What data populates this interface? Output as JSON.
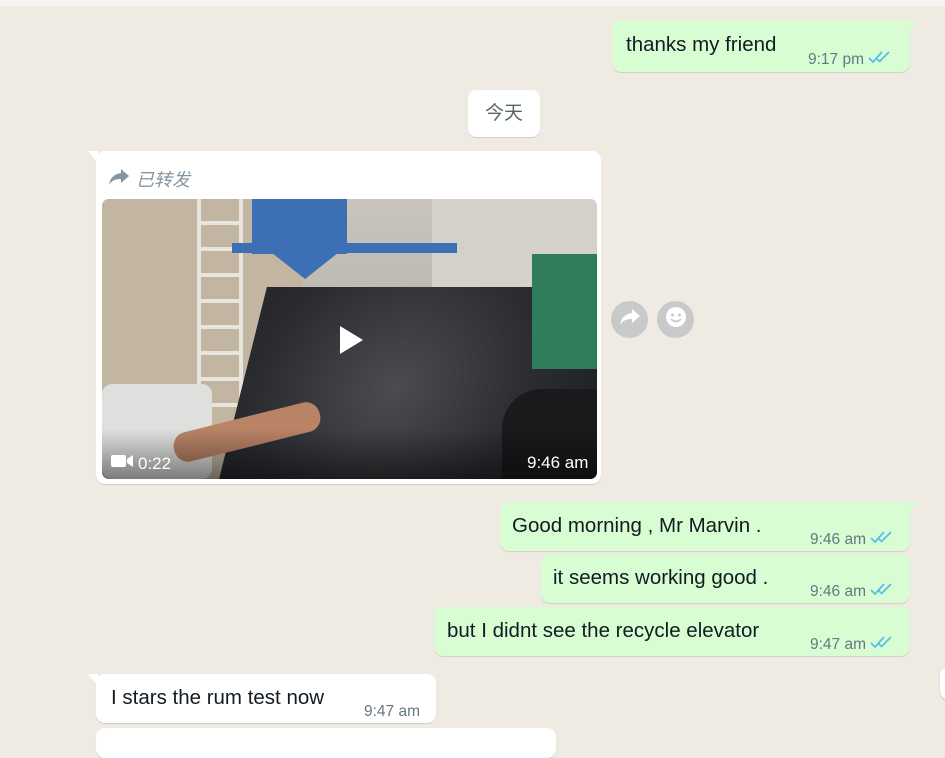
{
  "messages": [
    {
      "text": "thanks my friend",
      "time": "9:17 pm"
    },
    {
      "text": "Good morning , Mr Marvin .",
      "time": "9:46 am"
    },
    {
      "text": "it seems working good .",
      "time": "9:46 am"
    },
    {
      "text": "but I didnt see the recycle elevator",
      "time": "9:47 am"
    },
    {
      "text": "I stars the rum test now",
      "time": "9:47 am"
    }
  ],
  "date_separator": "今天",
  "forwarded_video": {
    "forwarded_label": "已转发",
    "duration": "0:22",
    "time": "9:46 am"
  },
  "icons": {
    "forwarded": "forward-arrow-icon",
    "video": "video-camera-icon",
    "play": "play-icon",
    "read_receipt": "double-check-icon",
    "share": "share-forward-icon",
    "react": "emoji-react-icon"
  },
  "colors": {
    "chat_background": "#efeae2",
    "outgoing_bubble": "#d9fdd3",
    "incoming_bubble": "#ffffff",
    "read_ticks": "#53bdeb",
    "meta_text": "#667781"
  }
}
